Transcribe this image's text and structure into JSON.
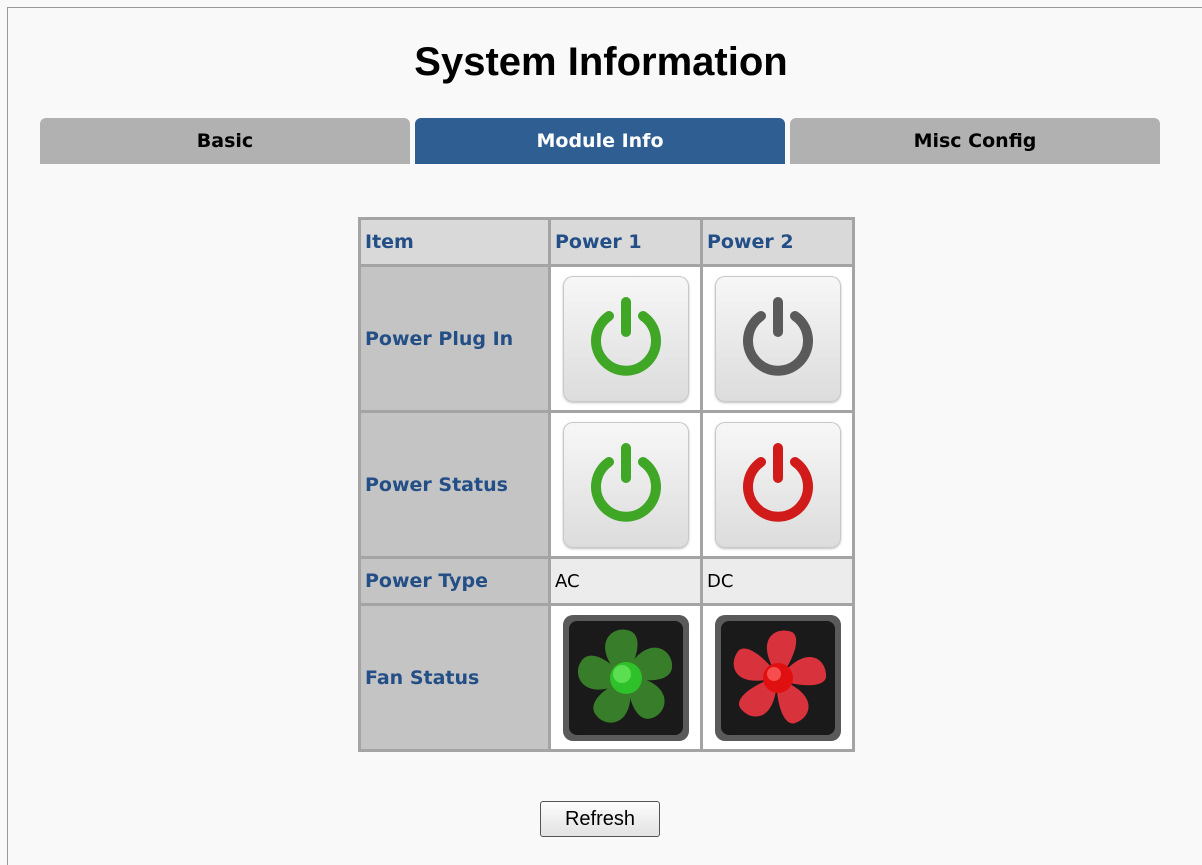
{
  "page": {
    "title": "System Information"
  },
  "tabs": [
    {
      "label": "Basic",
      "active": false
    },
    {
      "label": "Module Info",
      "active": true
    },
    {
      "label": "Misc Config",
      "active": false
    }
  ],
  "table": {
    "headers": [
      "Item",
      "Power 1",
      "Power 2"
    ],
    "rows": {
      "plug_in": {
        "label": "Power Plug In",
        "p1_icon": "power-icon-green",
        "p2_icon": "power-icon-gray"
      },
      "status": {
        "label": "Power Status",
        "p1_icon": "power-icon-green",
        "p2_icon": "power-icon-red"
      },
      "type": {
        "label": "Power Type",
        "p1": "AC",
        "p2": "DC"
      },
      "fan": {
        "label": "Fan Status",
        "p1_icon": "fan-icon-green",
        "p2_icon": "fan-icon-red"
      }
    }
  },
  "colors": {
    "tab_active": "#2f5e93",
    "label_text": "#234e86",
    "ok": "#3fa626",
    "off": "#5a5a5a",
    "fail": "#d11a1a"
  },
  "buttons": {
    "refresh": "Refresh"
  }
}
